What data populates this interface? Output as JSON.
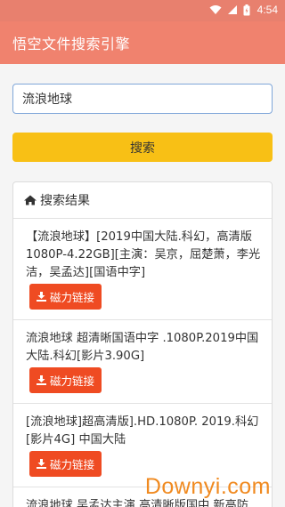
{
  "status_bar": {
    "time": "4:54"
  },
  "app_bar": {
    "title": "悟空文件搜索引擎"
  },
  "search": {
    "value": "流浪地球",
    "button_label": "搜索"
  },
  "results": {
    "header": "搜索结果",
    "items": [
      {
        "title": "【流浪地球】[2019中国大陆.科幻，高清版1080P-4.22GB][主演：吴京，屈楚萧，李光洁，吴孟达][国语中字]",
        "action": "磁力链接"
      },
      {
        "title": "流浪地球 超清晰国语中字 .1080P.2019中国大陆.科幻[影片3.90G]",
        "action": "磁力链接"
      },
      {
        "title": "[流浪地球]超高清版].HD.1080P. 2019.科幻[影片4G] 中国大陆",
        "action": "磁力链接"
      },
      {
        "title": "流浪地球 吴孟达主演 高清晰版国中 新高防",
        "action": ""
      }
    ]
  },
  "watermark": {
    "text": "Downyi.com"
  },
  "colors": {
    "accent": "#f0826e",
    "button": "#f8c015",
    "magnet": "#ef4b22"
  }
}
